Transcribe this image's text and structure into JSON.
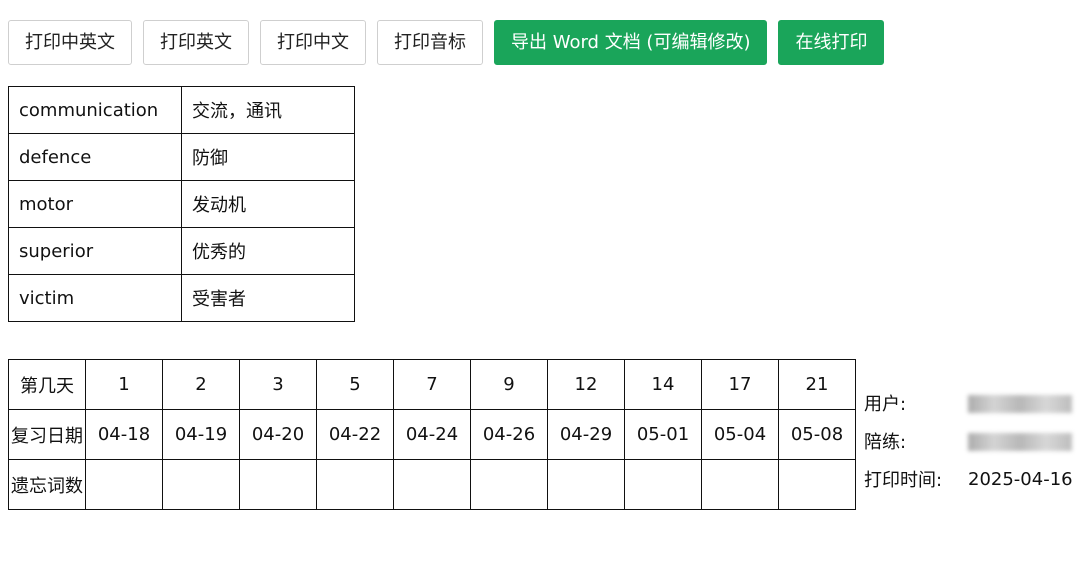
{
  "toolbar": {
    "buttons": [
      {
        "label": "打印中英文"
      },
      {
        "label": "打印英文"
      },
      {
        "label": "打印中文"
      },
      {
        "label": "打印音标"
      },
      {
        "label": "导出 Word 文档 (可编辑修改)"
      },
      {
        "label": "在线打印"
      }
    ]
  },
  "words": [
    {
      "en": "communication",
      "zh": "交流，通讯"
    },
    {
      "en": "defence",
      "zh": "防御"
    },
    {
      "en": "motor",
      "zh": "发动机"
    },
    {
      "en": "superior",
      "zh": "优秀的"
    },
    {
      "en": "victim",
      "zh": "受害者"
    }
  ],
  "schedule": {
    "row_labels": [
      "第几天",
      "复习日期",
      "遗忘词数"
    ],
    "days": [
      "1",
      "2",
      "3",
      "5",
      "7",
      "9",
      "12",
      "14",
      "17",
      "21"
    ],
    "dates": [
      "04-18",
      "04-19",
      "04-20",
      "04-22",
      "04-24",
      "04-26",
      "04-29",
      "05-01",
      "05-04",
      "05-08"
    ]
  },
  "info": {
    "user_label": "用户:",
    "coach_label": "陪练:",
    "print_time_label": "打印时间:",
    "print_time_value": "2025-04-16"
  },
  "colors": {
    "primary": "#1aa55a"
  }
}
